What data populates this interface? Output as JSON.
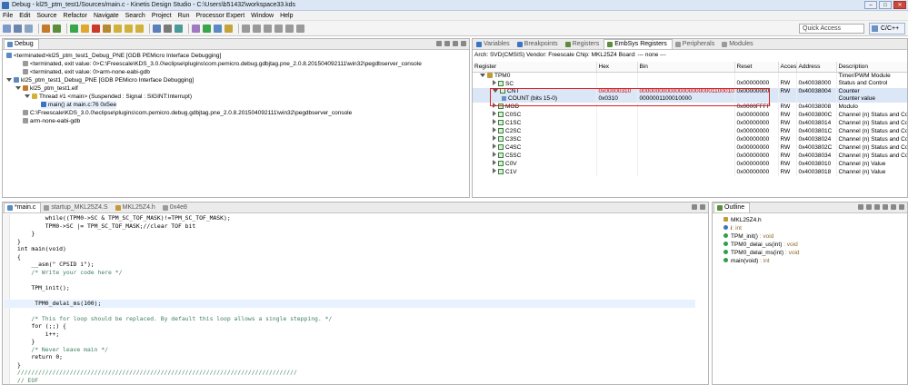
{
  "titlebar": {
    "title": "Debug - kl25_ptm_test1/Sources/main.c - Kinetis Design Studio - C:\\Users\\b51432\\workspace33.kds"
  },
  "window_controls": {
    "minimize": "–",
    "maximize": "□",
    "close": "✕"
  },
  "menu": [
    "File",
    "Edit",
    "Source",
    "Refactor",
    "Navigate",
    "Search",
    "Project",
    "Run",
    "Processor Expert",
    "Window",
    "Help"
  ],
  "toolbar": {
    "quick_access_placeholder": "Quick Access",
    "perspective": "C/C++"
  },
  "debug": {
    "tab": "Debug",
    "tree": [
      "<terminated>kl25_ptm_test1_Debug_PNE [GDB PEMicro Interface Debugging]",
      "<terminated, exit value: 0>C:\\Freescale\\KDS_3.0.0\\eclipse\\plugins\\com.pemicro.debug.gdbjtag.pne_2.0.8.201504092111\\win32\\pegdbserver_console",
      "<terminated, exit value: 0>arm-none-eabi-gdb",
      "kl25_ptm_test1_Debug_PNE [GDB PEMicro Interface Debugging]",
      "kl25_ptm_test1.elf",
      "Thread #1 <main> (Suspended : Signal : SIGINT:Interrupt)",
      "main() at main.c:76 0x5ee",
      "C:\\Freescale\\KDS_3.0.0\\eclipse\\plugins\\com.pemicro.debug.gdbjtag.pne_2.0.8.201504092111\\win32\\pegdbserver_console",
      "arm-none-eabi-gdb"
    ]
  },
  "registers_view": {
    "tabs": [
      "Variables",
      "Breakpoints",
      "Registers",
      "EmbSys Registers",
      "Peripherals",
      "Modules"
    ],
    "active_tab": "EmbSys Registers",
    "info": "Arch: SVD(CMSIS)  Vendor: Freescale  Chip: MKL25Z4  Board: --- none ---",
    "columns": [
      "Register",
      "Hex",
      "Bin",
      "Reset",
      "Access",
      "Address",
      "Description"
    ],
    "rows": [
      {
        "name": "TPM0",
        "hex": "",
        "bin": "",
        "reset": "",
        "access": "",
        "address": "",
        "desc": "Timer/PWM Module",
        "kind": "group"
      },
      {
        "name": "SC",
        "hex": "",
        "bin": "",
        "reset": "0x00000000",
        "access": "RW",
        "address": "0x40038000",
        "desc": "Status and Control",
        "kind": "reg"
      },
      {
        "name": "CNT",
        "hex": "0x00000310",
        "bin": "00000000000000000000001100010000",
        "reset": "0x00000000",
        "access": "RW",
        "address": "0x40038004",
        "desc": "Counter",
        "kind": "reg-open"
      },
      {
        "name": "COUNT (bits 15-0)",
        "hex": "0x0310",
        "bin": "0000001100010000",
        "reset": "",
        "access": "",
        "address": "",
        "desc": "Counter value",
        "kind": "field"
      },
      {
        "name": "MOD",
        "hex": "",
        "bin": "",
        "reset": "0x0000FFFF",
        "access": "RW",
        "address": "0x40038008",
        "desc": "Modulo",
        "kind": "reg"
      },
      {
        "name": "C0SC",
        "hex": "",
        "bin": "",
        "reset": "0x00000000",
        "access": "RW",
        "address": "0x4003800C",
        "desc": "Channel (n) Status and Control",
        "kind": "reg"
      },
      {
        "name": "C1SC",
        "hex": "",
        "bin": "",
        "reset": "0x00000000",
        "access": "RW",
        "address": "0x40038014",
        "desc": "Channel (n) Status and Control",
        "kind": "reg"
      },
      {
        "name": "C2SC",
        "hex": "",
        "bin": "",
        "reset": "0x00000000",
        "access": "RW",
        "address": "0x4003801C",
        "desc": "Channel (n) Status and Control",
        "kind": "reg"
      },
      {
        "name": "C3SC",
        "hex": "",
        "bin": "",
        "reset": "0x00000000",
        "access": "RW",
        "address": "0x40038024",
        "desc": "Channel (n) Status and Control",
        "kind": "reg"
      },
      {
        "name": "C4SC",
        "hex": "",
        "bin": "",
        "reset": "0x00000000",
        "access": "RW",
        "address": "0x4003802C",
        "desc": "Channel (n) Status and Control",
        "kind": "reg"
      },
      {
        "name": "C5SC",
        "hex": "",
        "bin": "",
        "reset": "0x00000000",
        "access": "RW",
        "address": "0x40038034",
        "desc": "Channel (n) Status and Control",
        "kind": "reg"
      },
      {
        "name": "C0V",
        "hex": "",
        "bin": "",
        "reset": "0x00000000",
        "access": "RW",
        "address": "0x40038010",
        "desc": "Channel (n) Value",
        "kind": "reg"
      },
      {
        "name": "C1V",
        "hex": "",
        "bin": "",
        "reset": "0x00000000",
        "access": "RW",
        "address": "0x40038018",
        "desc": "Channel (n) Value",
        "kind": "reg"
      }
    ]
  },
  "editor": {
    "tabs": [
      "*main.c",
      "startup_MKL25Z4.S",
      "MKL25Z4.h",
      "0x4e8"
    ],
    "lines": [
      "        while((TPM0->SC & TPM_SC_TOF_MASK)!=TPM_SC_TOF_MASK);",
      "        TPM0->SC |= TPM_SC_TOF_MASK;//clear TOF bit",
      "    }",
      "}",
      "int main(void)",
      "{",
      "    __asm(\" CPSID i\");",
      "    /* Write your code here */",
      "",
      "    TPM_init();",
      "",
      "     TPM0_delai_ms(100);",
      "",
      "    /* This for loop should be replaced. By default this loop allows a single stepping. */",
      "    for (;;) {",
      "        i++;",
      "    }",
      "    /* Never leave main */",
      "    return 0;",
      "}",
      "////////////////////////////////////////////////////////////////////////////////",
      "// EOF",
      "////////////////////////////////////////////////////////////////////////////////"
    ]
  },
  "outline": {
    "tab": "Outline",
    "items": [
      {
        "name": "MKL25Z4.h",
        "type": "",
        "kind": "include"
      },
      {
        "name": "i",
        "type": ": int",
        "kind": "var"
      },
      {
        "name": "TPM_init()",
        "type": " : void",
        "kind": "fn"
      },
      {
        "name": "TPM0_delai_us(int)",
        "type": " : void",
        "kind": "fn"
      },
      {
        "name": "TPM0_delai_ms(int)",
        "type": " : void",
        "kind": "fn"
      },
      {
        "name": "main(void)",
        "type": " : int",
        "kind": "fn"
      }
    ]
  }
}
